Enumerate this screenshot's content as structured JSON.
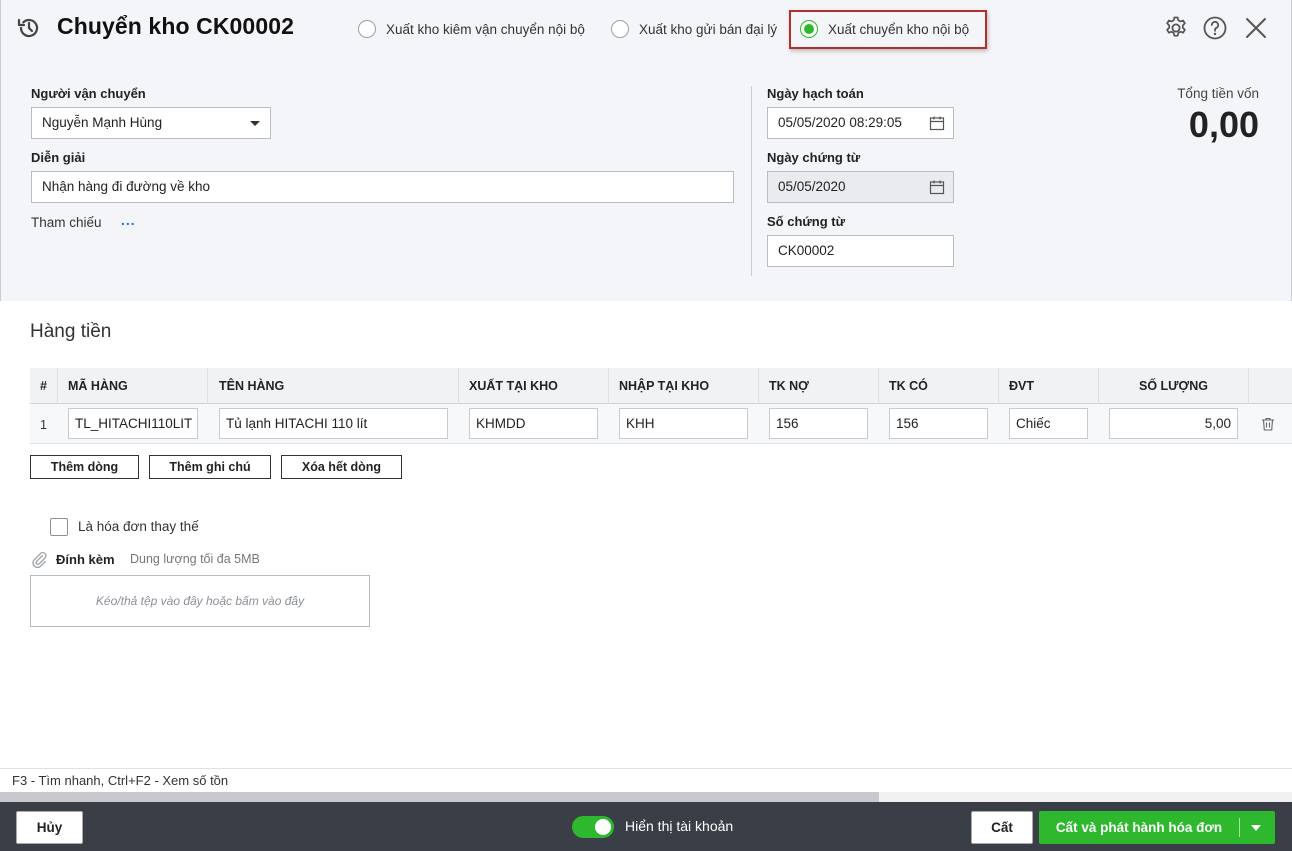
{
  "header": {
    "title": "Chuyển kho CK00002",
    "radios": [
      {
        "label": "Xuất kho kiêm vận chuyển nội bộ",
        "checked": false
      },
      {
        "label": "Xuất kho gửi bán đại lý",
        "checked": false
      },
      {
        "label": "Xuất chuyển kho nội bộ",
        "checked": true
      }
    ],
    "icons": [
      "history-icon",
      "gear-icon",
      "help-icon",
      "close-icon"
    ]
  },
  "form": {
    "carrier_label": "Người vận chuyển",
    "carrier_value": "Nguyễn Mạnh Hùng",
    "description_label": "Diễn giải",
    "description_value": "Nhận hàng đi đường về kho",
    "reference_label": "Tham chiếu",
    "reference_more": "...",
    "posting_date_label": "Ngày hạch toán",
    "posting_date_value": "05/05/2020 08:29:05",
    "voucher_date_label": "Ngày chứng từ",
    "voucher_date_value": "05/05/2020",
    "voucher_no_label": "Số chứng từ",
    "voucher_no_value": "CK00002",
    "total_label": "Tổng tiền vốn",
    "total_value": "0,00"
  },
  "grid": {
    "section_title": "Hàng tiền",
    "columns": [
      "#",
      "MÃ HÀNG",
      "TÊN HÀNG",
      "XUẤT TẠI KHO",
      "NHẬP TẠI KHO",
      "TK NỢ",
      "TK CÓ",
      "ĐVT",
      "SỐ LƯỢNG"
    ],
    "rows": [
      {
        "num": "1",
        "code": "TL_HITACHI110LIT",
        "name": "Tủ lạnh HITACHI 110 lít",
        "from": "KHMDD",
        "to": "KHH",
        "debit": "156",
        "credit": "156",
        "unit": "Chiếc",
        "qty": "5,00"
      }
    ],
    "buttons": {
      "add_row": "Thêm dòng",
      "add_note": "Thêm ghi chú",
      "delete_all": "Xóa hết dòng"
    }
  },
  "extra": {
    "replacement_label": "Là hóa đơn thay thế",
    "replacement_checked": false,
    "attach_label": "Đính kèm",
    "attach_hint": "Dung lượng tối đa 5MB",
    "drop_hint": "Kéo/thả tệp vào đây hoặc bấm vào đây"
  },
  "status": {
    "shortcuts": "F3 - Tìm nhanh, Ctrl+F2 - Xem số tồn",
    "scroll_position": 0.68
  },
  "footer": {
    "cancel": "Hủy",
    "toggle_label": "Hiển thị tài khoản",
    "toggle_on": true,
    "save": "Cất",
    "save_publish": "Cất và phát hành hóa đơn"
  },
  "colors": {
    "accent": "#2eb82e",
    "highlight_border": "#b03030",
    "footer_bg": "#3a3f47",
    "link": "#1a73e8"
  }
}
